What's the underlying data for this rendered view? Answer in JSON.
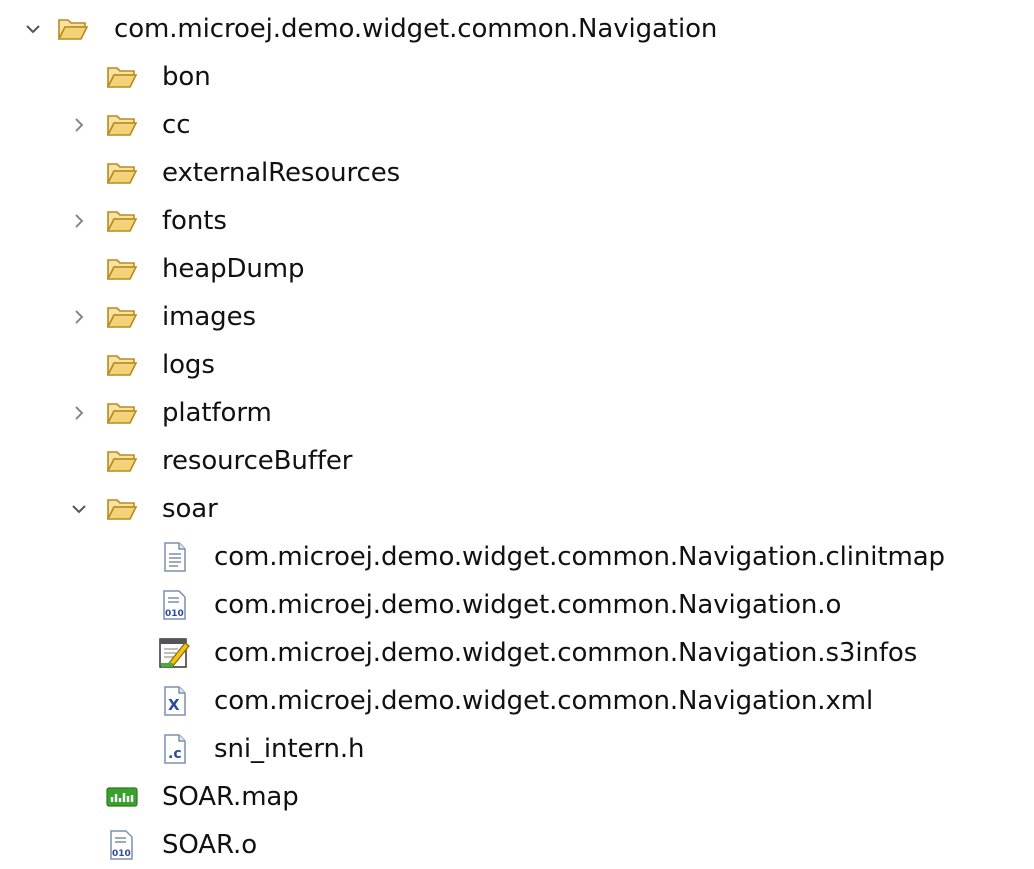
{
  "tree": {
    "root": {
      "label": "com.microej.demo.widget.common.Navigation",
      "expanded": true,
      "icon": "folder-open-icon"
    },
    "children": [
      {
        "label": "bon",
        "icon": "folder-open-icon",
        "expandable": false
      },
      {
        "label": "cc",
        "icon": "folder-open-icon",
        "expandable": true,
        "expanded": false
      },
      {
        "label": "externalResources",
        "icon": "folder-open-icon",
        "expandable": false
      },
      {
        "label": "fonts",
        "icon": "folder-open-icon",
        "expandable": true,
        "expanded": false
      },
      {
        "label": "heapDump",
        "icon": "folder-open-icon",
        "expandable": false
      },
      {
        "label": "images",
        "icon": "folder-open-icon",
        "expandable": true,
        "expanded": false
      },
      {
        "label": "logs",
        "icon": "folder-open-icon",
        "expandable": false
      },
      {
        "label": "platform",
        "icon": "folder-open-icon",
        "expandable": true,
        "expanded": false
      },
      {
        "label": "resourceBuffer",
        "icon": "folder-open-icon",
        "expandable": false
      },
      {
        "label": "soar",
        "icon": "folder-open-icon",
        "expandable": true,
        "expanded": true,
        "children": [
          {
            "label": "com.microej.demo.widget.common.Navigation.clinitmap",
            "icon": "text-file-icon"
          },
          {
            "label": "com.microej.demo.widget.common.Navigation.o",
            "icon": "binary-file-icon"
          },
          {
            "label": "com.microej.demo.widget.common.Navigation.s3infos",
            "icon": "edit-file-icon"
          },
          {
            "label": "com.microej.demo.widget.common.Navigation.xml",
            "icon": "xml-file-icon"
          },
          {
            "label": "sni_intern.h",
            "icon": "c-header-file-icon"
          }
        ]
      },
      {
        "label": "SOAR.map",
        "icon": "map-file-icon",
        "expandable": false
      },
      {
        "label": "SOAR.o",
        "icon": "binary-file-icon",
        "expandable": false
      }
    ]
  },
  "colors": {
    "folder_fill": "#F4D27A",
    "folder_stroke": "#B88A1E",
    "twisty": "#7A7A7A",
    "map_icon": "#3AA12E",
    "xml_icon": "#2B4A9C",
    "binary_icon": "#2B4A9C"
  }
}
